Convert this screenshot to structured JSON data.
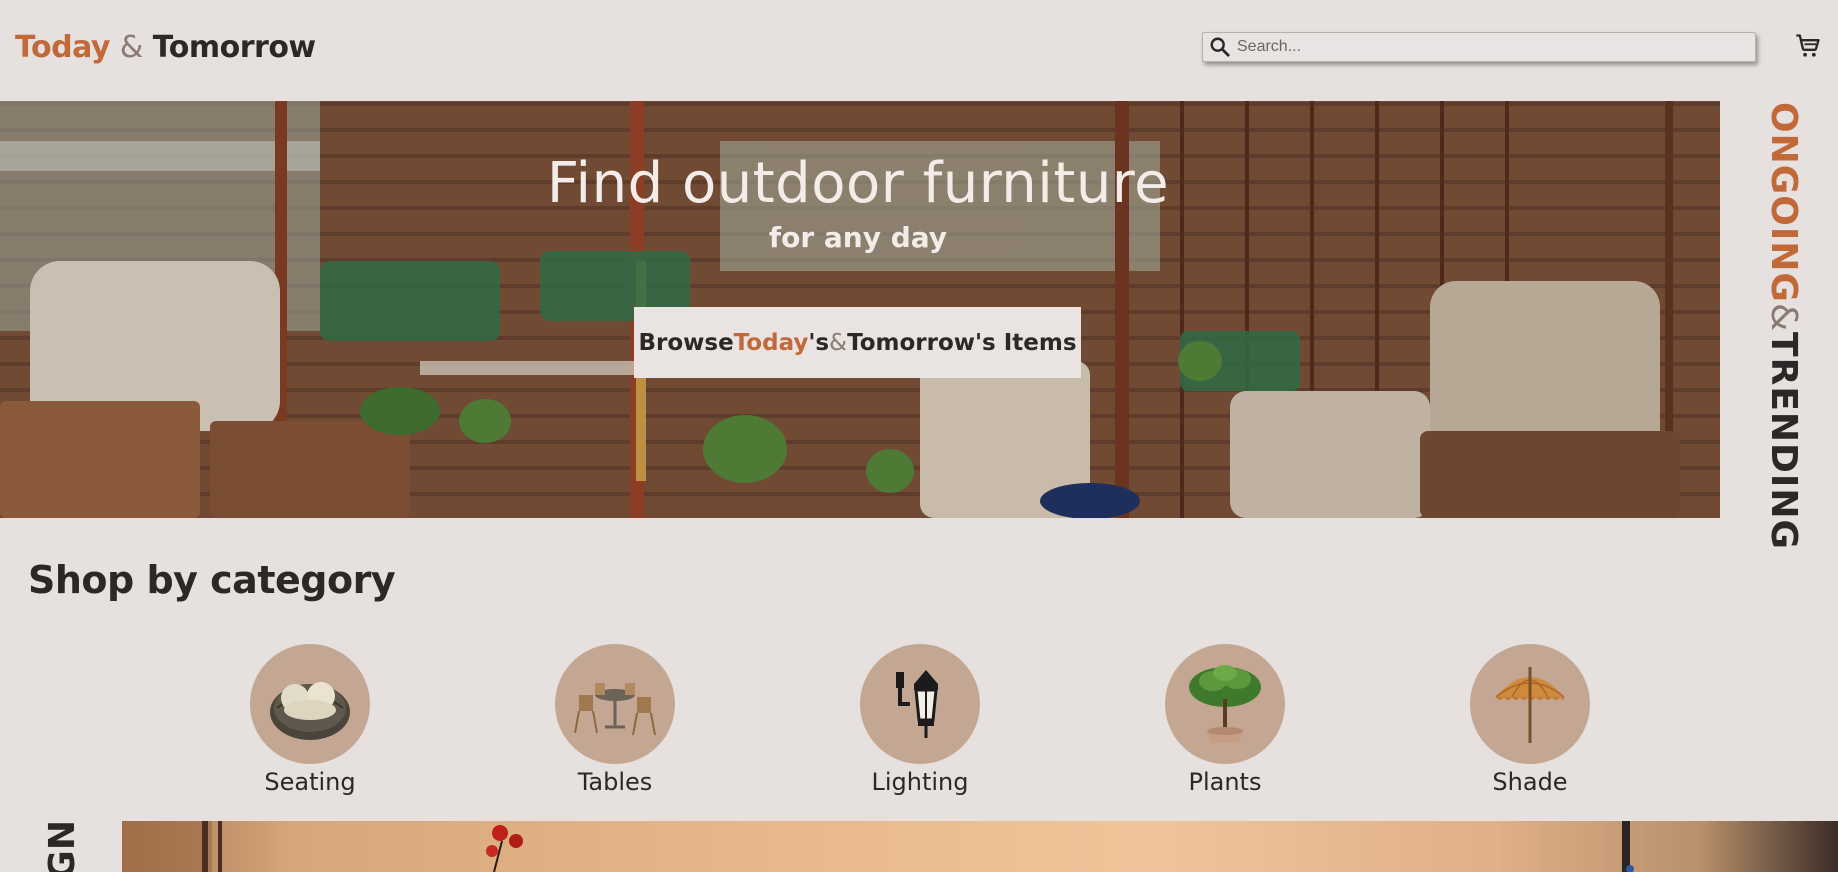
{
  "header": {
    "logo": {
      "part1": "Today",
      "amp": "&",
      "part2": "Tomorrow"
    },
    "search": {
      "placeholder": "Search...",
      "value": ""
    },
    "cart_icon": "shopping-cart-icon"
  },
  "hero": {
    "title": "Find outdoor furniture",
    "subtitle": "for any day",
    "button": {
      "prefix": "Browse ",
      "today": "Today",
      "mid": "'s ",
      "amp": "&",
      "suffix": " Tomorrow's Items"
    }
  },
  "side_label": {
    "accent": "ONGOING",
    "amp": "&",
    "dark": "TRENDING"
  },
  "category_section": {
    "title": "Shop by category",
    "items": [
      {
        "label": "Seating",
        "icon": "seating-icon"
      },
      {
        "label": "Tables",
        "icon": "tables-icon"
      },
      {
        "label": "Lighting",
        "icon": "lighting-icon"
      },
      {
        "label": "Plants",
        "icon": "plants-icon"
      },
      {
        "label": "Shade",
        "icon": "shade-icon"
      }
    ]
  },
  "bottom_label": {
    "text": "GN"
  },
  "colors": {
    "accent": "#c2693a",
    "background": "#e6e0df",
    "circle": "#c4a793",
    "text": "#2c2828"
  }
}
